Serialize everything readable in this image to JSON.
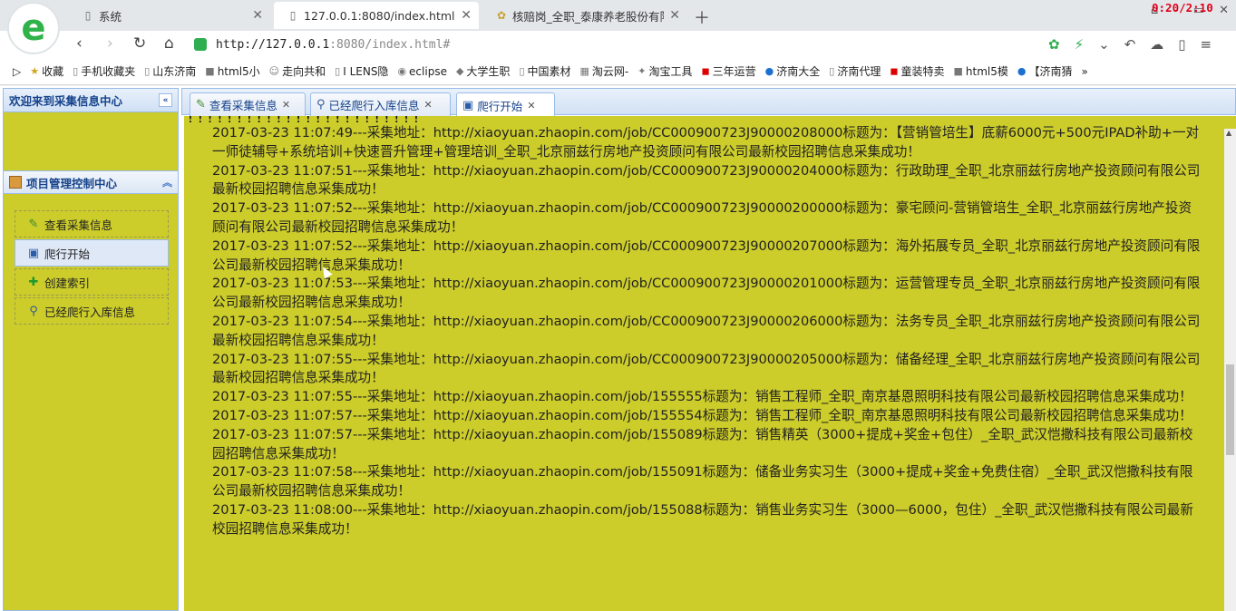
{
  "browser": {
    "tabs": [
      {
        "icon": "page-icon",
        "label": "系统"
      },
      {
        "icon": "page-icon",
        "label": "127.0.0.1:8080/index.html#"
      },
      {
        "icon": "flower-icon",
        "label": "核赔岗_全职_泰康养老股份有限公"
      }
    ],
    "timer": "0:20/2:10",
    "url_host": "http://127.0.0.1",
    "url_rest": ":8080/index.html#",
    "bookmarks": [
      "收藏",
      "手机收藏夹",
      "山东济南",
      "html5小",
      "走向共和",
      "I LENS隐",
      "eclipse",
      "大学生职",
      "中国素材",
      "淘云网-",
      "淘宝工具",
      "三年运营",
      "济南大全",
      "济南代理",
      "童装特卖",
      "html5模",
      "【济南猜"
    ],
    "more": "»"
  },
  "sidebar": {
    "title": "欢迎来到采集信息中心",
    "panel_title": "项目管理控制中心",
    "menu": [
      {
        "label": "查看采集信息",
        "icon": "pencil-icon"
      },
      {
        "label": "爬行开始",
        "icon": "save-icon"
      },
      {
        "label": "创建索引",
        "icon": "plus-icon"
      },
      {
        "label": "已经爬行入库信息",
        "icon": "magnifier-icon"
      }
    ]
  },
  "main": {
    "tabs": [
      {
        "label": "查看采集信息",
        "icon": "pencil-icon"
      },
      {
        "label": "已经爬行入库信息",
        "icon": "magnifier-icon"
      },
      {
        "label": "爬行开始",
        "icon": "save-icon"
      }
    ],
    "bangs": "!!!!!!!!!!!!!!!!!!!!!!!!",
    "log": [
      "2017-03-23 11:07:49---采集地址：http://xiaoyuan.zhaopin.com/job/CC000900723J90000208000标题为：【营销管培生】底薪6000元+500元IPAD补助+一对一师徒辅导+系统培训+快速晋升管理+管理培训_全职_北京丽兹行房地产投资顾问有限公司最新校园招聘信息采集成功！",
      "2017-03-23 11:07:51---采集地址：http://xiaoyuan.zhaopin.com/job/CC000900723J90000204000标题为：行政助理_全职_北京丽兹行房地产投资顾问有限公司最新校园招聘信息采集成功！",
      "2017-03-23 11:07:52---采集地址：http://xiaoyuan.zhaopin.com/job/CC000900723J90000200000标题为：豪宅顾问-营销管培生_全职_北京丽兹行房地产投资顾问有限公司最新校园招聘信息采集成功！",
      "2017-03-23 11:07:52---采集地址：http://xiaoyuan.zhaopin.com/job/CC000900723J90000207000标题为：海外拓展专员_全职_北京丽兹行房地产投资顾问有限公司最新校园招聘信息采集成功！",
      "2017-03-23 11:07:53---采集地址：http://xiaoyuan.zhaopin.com/job/CC000900723J90000201000标题为：运营管理专员_全职_北京丽兹行房地产投资顾问有限公司最新校园招聘信息采集成功！",
      "2017-03-23 11:07:54---采集地址：http://xiaoyuan.zhaopin.com/job/CC000900723J90000206000标题为：法务专员_全职_北京丽兹行房地产投资顾问有限公司最新校园招聘信息采集成功！",
      "2017-03-23 11:07:55---采集地址：http://xiaoyuan.zhaopin.com/job/CC000900723J90000205000标题为：储备经理_全职_北京丽兹行房地产投资顾问有限公司最新校园招聘信息采集成功！",
      "2017-03-23 11:07:55---采集地址：http://xiaoyuan.zhaopin.com/job/155555标题为：销售工程师_全职_南京基恩照明科技有限公司最新校园招聘信息采集成功！",
      "2017-03-23 11:07:57---采集地址：http://xiaoyuan.zhaopin.com/job/155554标题为：销售工程师_全职_南京基恩照明科技有限公司最新校园招聘信息采集成功！",
      "2017-03-23 11:07:57---采集地址：http://xiaoyuan.zhaopin.com/job/155089标题为：销售精英（3000+提成+奖金+包住）_全职_武汉恺撒科技有限公司最新校园招聘信息采集成功！",
      "2017-03-23 11:07:58---采集地址：http://xiaoyuan.zhaopin.com/job/155091标题为：储备业务实习生（3000+提成+奖金+免费住宿）_全职_武汉恺撒科技有限公司最新校园招聘信息采集成功！",
      "2017-03-23 11:08:00---采集地址：http://xiaoyuan.zhaopin.com/job/155088标题为：销售业务实习生（3000—6000，包住）_全职_武汉恺撒科技有限公司最新校园招聘信息采集成功！"
    ]
  },
  "colors": {
    "content_bg": "#cccc2b",
    "accent": "#15428b"
  }
}
